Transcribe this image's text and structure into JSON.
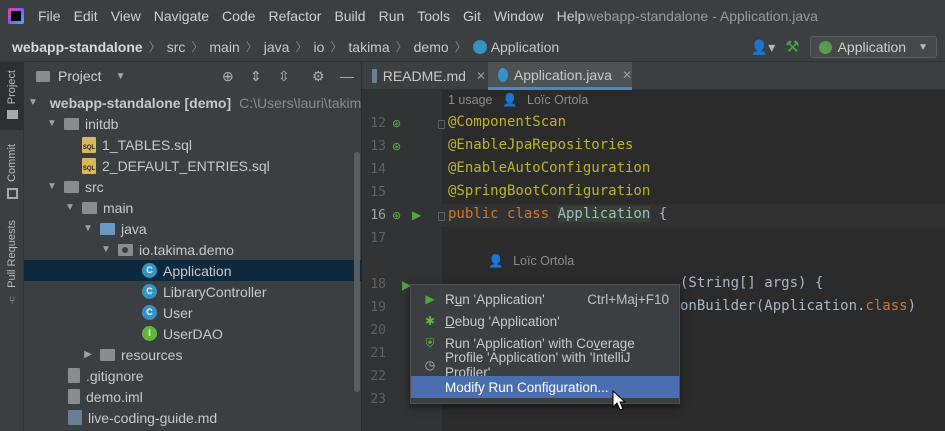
{
  "menubar": {
    "items": [
      "File",
      "Edit",
      "View",
      "Navigate",
      "Code",
      "Refactor",
      "Build",
      "Run",
      "Tools",
      "Git",
      "Window",
      "Help"
    ],
    "window_title": "webapp-standalone - Application.java"
  },
  "navbar": {
    "crumbs": [
      "webapp-standalone",
      "src",
      "main",
      "java",
      "io",
      "takima",
      "demo",
      "Application"
    ],
    "run_config": "Application"
  },
  "toolstrip": {
    "project": "Project",
    "commit": "Commit",
    "pull_requests": "Pull Requests"
  },
  "project": {
    "title": "Project",
    "tree": [
      {
        "label": "webapp-standalone [demo]",
        "path": "C:\\Users\\lauri\\takima\\tr"
      },
      {
        "label": "initdb"
      },
      {
        "label": "1_TABLES.sql"
      },
      {
        "label": "2_DEFAULT_ENTRIES.sql"
      },
      {
        "label": "src"
      },
      {
        "label": "main"
      },
      {
        "label": "java"
      },
      {
        "label": "io.takima.demo"
      },
      {
        "label": "Application"
      },
      {
        "label": "LibraryController"
      },
      {
        "label": "User"
      },
      {
        "label": "UserDAO"
      },
      {
        "label": "resources"
      },
      {
        "label": ".gitignore"
      },
      {
        "label": "demo.iml"
      },
      {
        "label": "live-coding-guide.md"
      }
    ]
  },
  "editor": {
    "tabs": [
      {
        "label": "README.md"
      },
      {
        "label": "Application.java"
      }
    ],
    "hint1": {
      "usage": "1 usage",
      "author": "Loïc Ortola"
    },
    "hint2": {
      "author": "Loïc Ortola"
    },
    "lines": [
      "12",
      "13",
      "14",
      "15",
      "16",
      "17",
      "18",
      "19",
      "20",
      "21",
      "22",
      "23"
    ],
    "code": {
      "l12": "@ComponentScan",
      "l13": "@EnableJpaRepositories",
      "l14": "@EnableAutoConfiguration",
      "l15": "@SpringBootConfiguration",
      "l16_kw": "public class ",
      "l16_cls": "Application",
      "l16_end": " {",
      "l18_tail": "(String[] args) {",
      "l19_tail_a": "onBuilder(",
      "l19_tail_b": "Application",
      "l19_tail_c": ".",
      "l19_tail_d": "class",
      "l19_tail_e": ")",
      "l23": "}"
    }
  },
  "popup": {
    "items": [
      {
        "pre": "R",
        "u": "u",
        "post": "n 'Application'",
        "shortcut": "Ctrl+Maj+F10"
      },
      {
        "pre": "",
        "u": "D",
        "post": "ebug 'Application'",
        "shortcut": ""
      },
      {
        "pre": "Run 'Application' with Co",
        "u": "v",
        "post": "erage",
        "shortcut": ""
      },
      {
        "pre": "Profile 'Application' with 'IntelliJ Profiler'",
        "u": "",
        "post": "",
        "shortcut": ""
      },
      {
        "pre": "Modify Run Configuration...",
        "u": "",
        "post": "",
        "shortcut": ""
      }
    ]
  }
}
